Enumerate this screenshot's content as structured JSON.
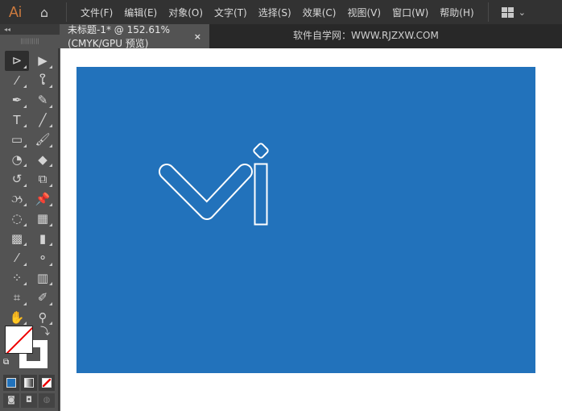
{
  "app": {
    "logo": "Ai"
  },
  "menu": [
    "文件(F)",
    "编辑(E)",
    "对象(O)",
    "文字(T)",
    "选择(S)",
    "效果(C)",
    "视图(V)",
    "窗口(W)",
    "帮助(H)"
  ],
  "tab": {
    "title": "未标题-1* @ 152.61% (CMYK/GPU 预览)",
    "close": "×"
  },
  "watermark": "软件自学网：WWW.RJZXW.COM",
  "tools": [
    {
      "name": "selection-tool",
      "glyph": "⊳"
    },
    {
      "name": "direct-selection-tool",
      "glyph": "▶"
    },
    {
      "name": "magic-wand-tool",
      "glyph": "⁄"
    },
    {
      "name": "lasso-tool",
      "glyph": "ໃ"
    },
    {
      "name": "pen-tool",
      "glyph": "✒"
    },
    {
      "name": "curvature-tool",
      "glyph": "✎"
    },
    {
      "name": "type-tool",
      "glyph": "T"
    },
    {
      "name": "line-tool",
      "glyph": "╱"
    },
    {
      "name": "rectangle-tool",
      "glyph": "▭"
    },
    {
      "name": "paintbrush-tool",
      "glyph": "🖌"
    },
    {
      "name": "shaper-tool",
      "glyph": "◔"
    },
    {
      "name": "eraser-tool",
      "glyph": "◆"
    },
    {
      "name": "rotate-tool",
      "glyph": "↺"
    },
    {
      "name": "scale-tool",
      "glyph": "⧉"
    },
    {
      "name": "warp-tool",
      "glyph": "ઝ"
    },
    {
      "name": "puppet-warp-tool",
      "glyph": "📌"
    },
    {
      "name": "shape-builder-tool",
      "glyph": "◌"
    },
    {
      "name": "perspective-grid-tool",
      "glyph": "▦"
    },
    {
      "name": "mesh-tool",
      "glyph": "▩"
    },
    {
      "name": "gradient-tool",
      "glyph": "▮"
    },
    {
      "name": "eyedropper-tool",
      "glyph": "⁄"
    },
    {
      "name": "blend-tool",
      "glyph": "⚬"
    },
    {
      "name": "symbol-sprayer-tool",
      "glyph": "⁘"
    },
    {
      "name": "column-graph-tool",
      "glyph": "▥"
    },
    {
      "name": "artboard-tool",
      "glyph": "⌗"
    },
    {
      "name": "slice-tool",
      "glyph": "✐"
    },
    {
      "name": "hand-tool",
      "glyph": "✋"
    },
    {
      "name": "zoom-tool",
      "glyph": "⚲"
    }
  ],
  "colors": {
    "artboard": "#2272bb",
    "stroke": "#ffffff",
    "fill_none_slash": "#e00000"
  }
}
